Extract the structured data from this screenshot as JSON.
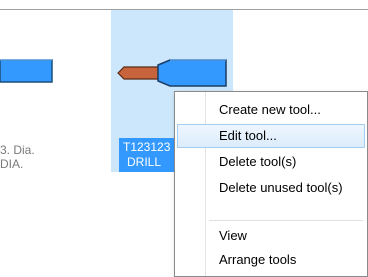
{
  "tools": [
    {
      "label_line1": "3. Dia.",
      "label_line2": "DIA."
    },
    {
      "label_line1": "T123123",
      "label_line2": "DRILL",
      "selected": true
    }
  ],
  "context_menu": {
    "items": [
      {
        "label": "Create new tool..."
      },
      {
        "label": "Edit tool...",
        "hover": true
      },
      {
        "label": "Delete tool(s)"
      },
      {
        "label": "Delete unused tool(s)"
      },
      {
        "label": "View"
      },
      {
        "label": "Arrange tools"
      }
    ]
  },
  "colors": {
    "selection_bg": "#cce6fb",
    "label_highlight": "#3399ff",
    "tool_body": "#3399ff",
    "tool_tip": "#c8643c"
  },
  "icons": [
    "tool-left-icon",
    "drill-tool-icon"
  ]
}
